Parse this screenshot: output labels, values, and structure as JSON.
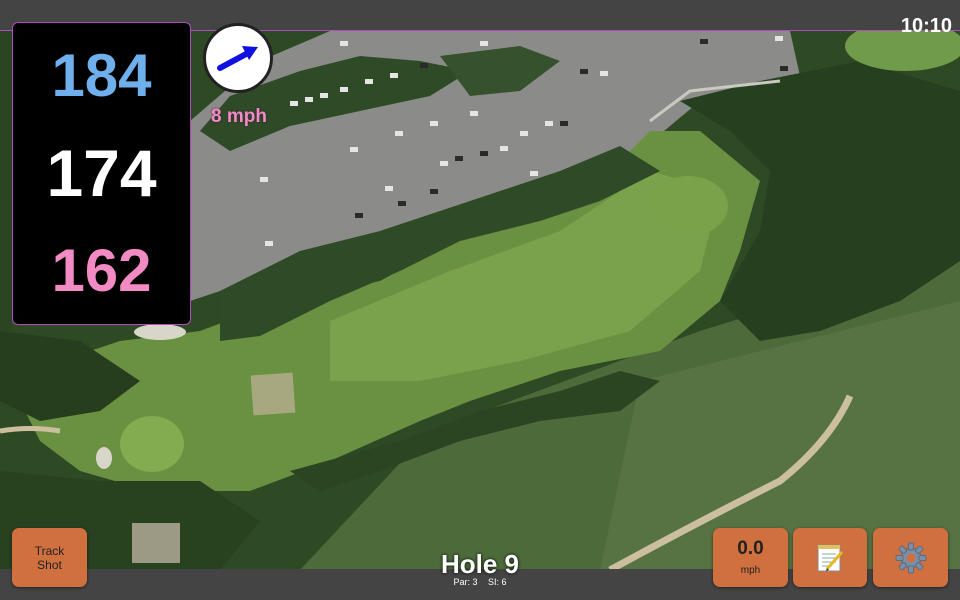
{
  "status": {
    "time": "10:10"
  },
  "distances": {
    "back": "184",
    "middle": "174",
    "front": "162"
  },
  "wind": {
    "speed_label": "8 mph",
    "direction_icon": "wind-arrow-icon"
  },
  "hole": {
    "title": "Hole 9",
    "par": "Par: 3",
    "si": "SI: 6"
  },
  "buttons": {
    "track_shot": {
      "line1": "Track",
      "line2": "Shot"
    },
    "wind_speed": {
      "value": "0.0",
      "unit": "mph"
    },
    "notes": {
      "icon": "notepad-icon"
    },
    "settings": {
      "icon": "gear-icon"
    }
  },
  "colors": {
    "back_distance": "#6fb0ec",
    "middle_distance": "#ffffff",
    "front_distance": "#f28ac3",
    "button": "#d0703f",
    "accent_border": "#b04cc0"
  }
}
